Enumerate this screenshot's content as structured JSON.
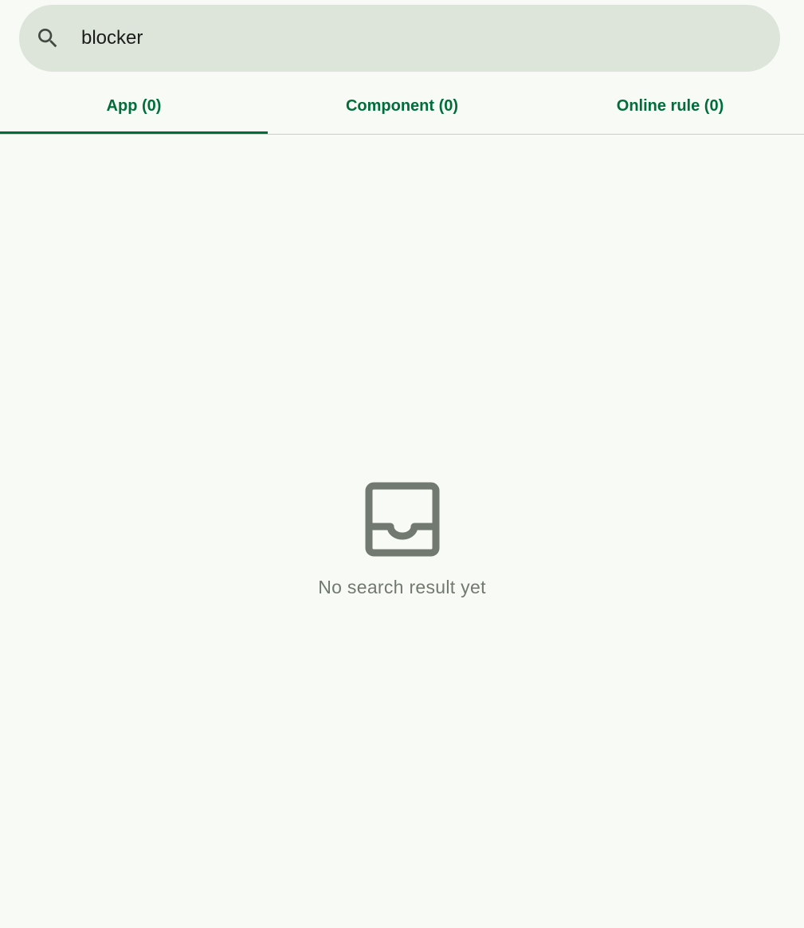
{
  "search": {
    "value": "blocker",
    "icon": "search-icon"
  },
  "tabs": [
    {
      "label": "App (0)",
      "selected": true
    },
    {
      "label": "Component (0)",
      "selected": false
    },
    {
      "label": "Online rule (0)",
      "selected": false
    }
  ],
  "empty_state": {
    "icon": "inbox-icon",
    "message": "No search result yet"
  },
  "colors": {
    "accent": "#006d3b",
    "background": "#f8fbf5",
    "search_bg": "#dde5db",
    "muted": "#727970"
  }
}
